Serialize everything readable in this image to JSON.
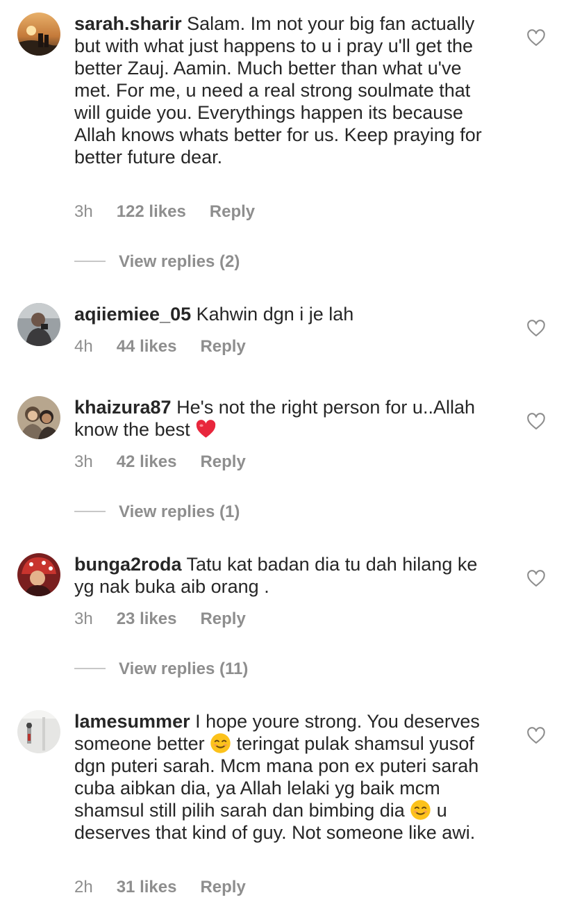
{
  "comments": [
    {
      "username": "sarah.sharir",
      "text": "Salam. Im not your big fan actually but with what just happens to u i pray u'll get the better Zauj. Aamin. Much better than what u've met. For me, u need a real strong soulmate that will guide you. Everythings happen its because Allah knows whats better for us. Keep praying for better future dear.",
      "time": "3h",
      "likes": "122 likes",
      "reply": "Reply",
      "view_replies": "View replies (2)"
    },
    {
      "username": "aqiiemiee_05",
      "text": "Kahwin dgn i je lah",
      "time": "4h",
      "likes": "44 likes",
      "reply": "Reply"
    },
    {
      "username": "khaizura87",
      "text_before": "He's not the right person for u..Allah know the best",
      "emoji": "red-heart-emoji",
      "time": "3h",
      "likes": "42 likes",
      "reply": "Reply",
      "view_replies": "View replies (1)"
    },
    {
      "username": "bunga2roda",
      "text": "Tatu kat badan dia tu dah hilang ke yg nak buka aib orang .",
      "time": "3h",
      "likes": "23 likes",
      "reply": "Reply",
      "view_replies": "View replies (11)"
    },
    {
      "username": "lamesummer",
      "text_part1": "I hope youre strong. You deserves someone better",
      "text_part2": "teringat pulak shamsul yusof dgn puteri sarah. Mcm mana pon ex puteri sarah cuba aibkan dia, ya Allah lelaki yg baik mcm shamsul still pilih sarah dan bimbing dia",
      "text_part3": "u deserves that kind of guy. Not someone like awi.",
      "emoji": "smiling-face-emoji",
      "time": "2h",
      "likes": "31 likes",
      "reply": "Reply"
    }
  ],
  "colors": {
    "text": "#262626",
    "secondary": "#8e8e8e",
    "divider": "#c7c7c7",
    "heart_outline": "#8e8e8e"
  }
}
